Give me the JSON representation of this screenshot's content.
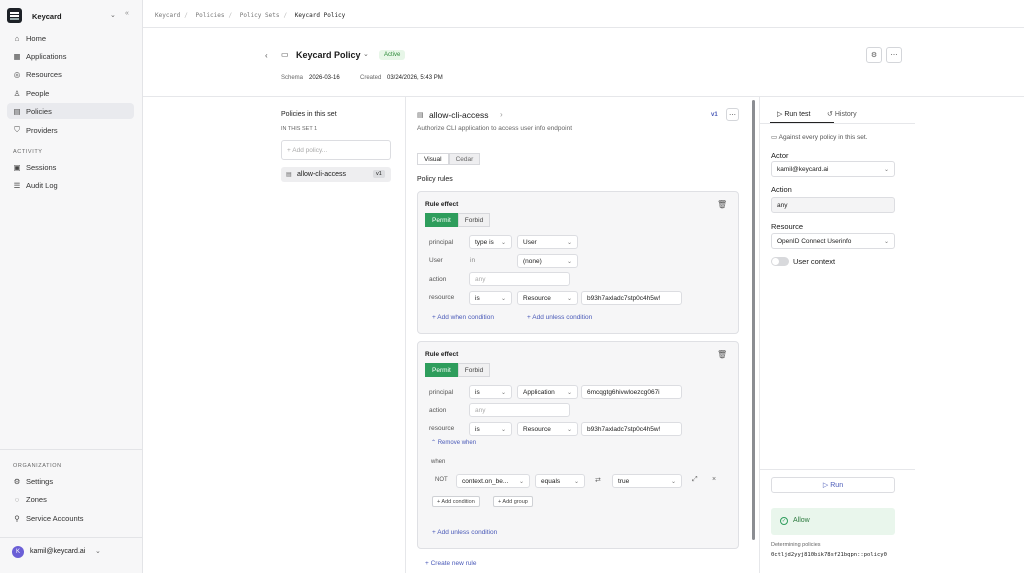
{
  "sidebar": {
    "org_name": "Keycard",
    "nav": [
      {
        "label": "Home",
        "icon": "home-icon"
      },
      {
        "label": "Applications",
        "icon": "applications-icon"
      },
      {
        "label": "Resources",
        "icon": "resources-icon"
      },
      {
        "label": "People",
        "icon": "people-icon"
      },
      {
        "label": "Policies",
        "icon": "policies-icon"
      },
      {
        "label": "Providers",
        "icon": "providers-icon"
      }
    ],
    "activity_heading": "ACTIVITY",
    "activity": [
      {
        "label": "Sessions",
        "icon": "sessions-icon"
      },
      {
        "label": "Audit Log",
        "icon": "audit-log-icon"
      }
    ],
    "organization_heading": "ORGANIZATION",
    "organization": [
      {
        "label": "Settings",
        "icon": "settings-icon"
      },
      {
        "label": "Zones",
        "icon": "zones-icon"
      },
      {
        "label": "Service Accounts",
        "icon": "service-accounts-icon"
      }
    ],
    "user": {
      "initial": "K",
      "email": "kamil@keycard.ai"
    }
  },
  "breadcrumbs": [
    "Keycard",
    "Policies",
    "Policy Sets",
    "Keycard Policy"
  ],
  "header": {
    "title": "Keycard Policy",
    "status": "Active",
    "schema_label": "Schema",
    "schema_value": "2026-03-16",
    "created_label": "Created",
    "created_value": "03/24/2026, 5:43 PM"
  },
  "policies_panel": {
    "title": "Policies in this set",
    "subheading": "IN THIS SET 1",
    "add_placeholder": "+  Add policy...",
    "items": [
      {
        "name": "allow-cli-access",
        "version": "v1"
      }
    ]
  },
  "editor": {
    "policy_name": "allow-cli-access",
    "version": "v1",
    "description": "Authorize CLI application to access user info endpoint",
    "tabs": [
      "Visual",
      "Cedar"
    ],
    "rules_heading": "Policy rules",
    "effect_label": "Rule effect",
    "permit": "Permit",
    "forbid": "Forbid",
    "rule1": {
      "principal": {
        "label": "principal",
        "op": "type is",
        "value": "User"
      },
      "user": {
        "label": "User",
        "op": "in",
        "value": "(none)"
      },
      "action": {
        "label": "action",
        "placeholder": "any"
      },
      "resource": {
        "label": "resource",
        "op": "is",
        "type": "Resource",
        "value": "b93h7axladc7stp0c4h5w!"
      },
      "add_when": "Add when condition",
      "add_unless": "Add unless condition"
    },
    "rule2": {
      "principal": {
        "label": "principal",
        "op": "is",
        "type": "Application",
        "value": "6mcqgtg6hivwloezcg067i"
      },
      "action": {
        "label": "action",
        "placeholder": "any"
      },
      "resource": {
        "label": "resource",
        "op": "is",
        "type": "Resource",
        "value": "b93h7axladc7stp0c4h5w!"
      },
      "remove_when": "Remove when",
      "when_label": "when",
      "not_label": "NOT",
      "cond_attr": "context.on_be...",
      "cond_op": "equals",
      "cond_value": "true",
      "add_condition": "+ Add condition",
      "add_group": "+ Add group",
      "add_unless": "Add unless condition"
    },
    "create_rule": "Create new rule"
  },
  "run_panel": {
    "tab_run": "Run test",
    "tab_history": "History",
    "scope_text": "Against every policy in this set.",
    "actor_label": "Actor",
    "actor_value": "kamil@keycard.ai",
    "action_label": "Action",
    "action_value": "any",
    "resource_label": "Resource",
    "resource_value": "OpenID Connect Userinfo",
    "user_context": "User context",
    "run_button": "Run",
    "result": "Allow",
    "determining_label": "Determining policies",
    "determining_value": "0ctljd2yyj810bik78sf21bqpn::policy0"
  }
}
